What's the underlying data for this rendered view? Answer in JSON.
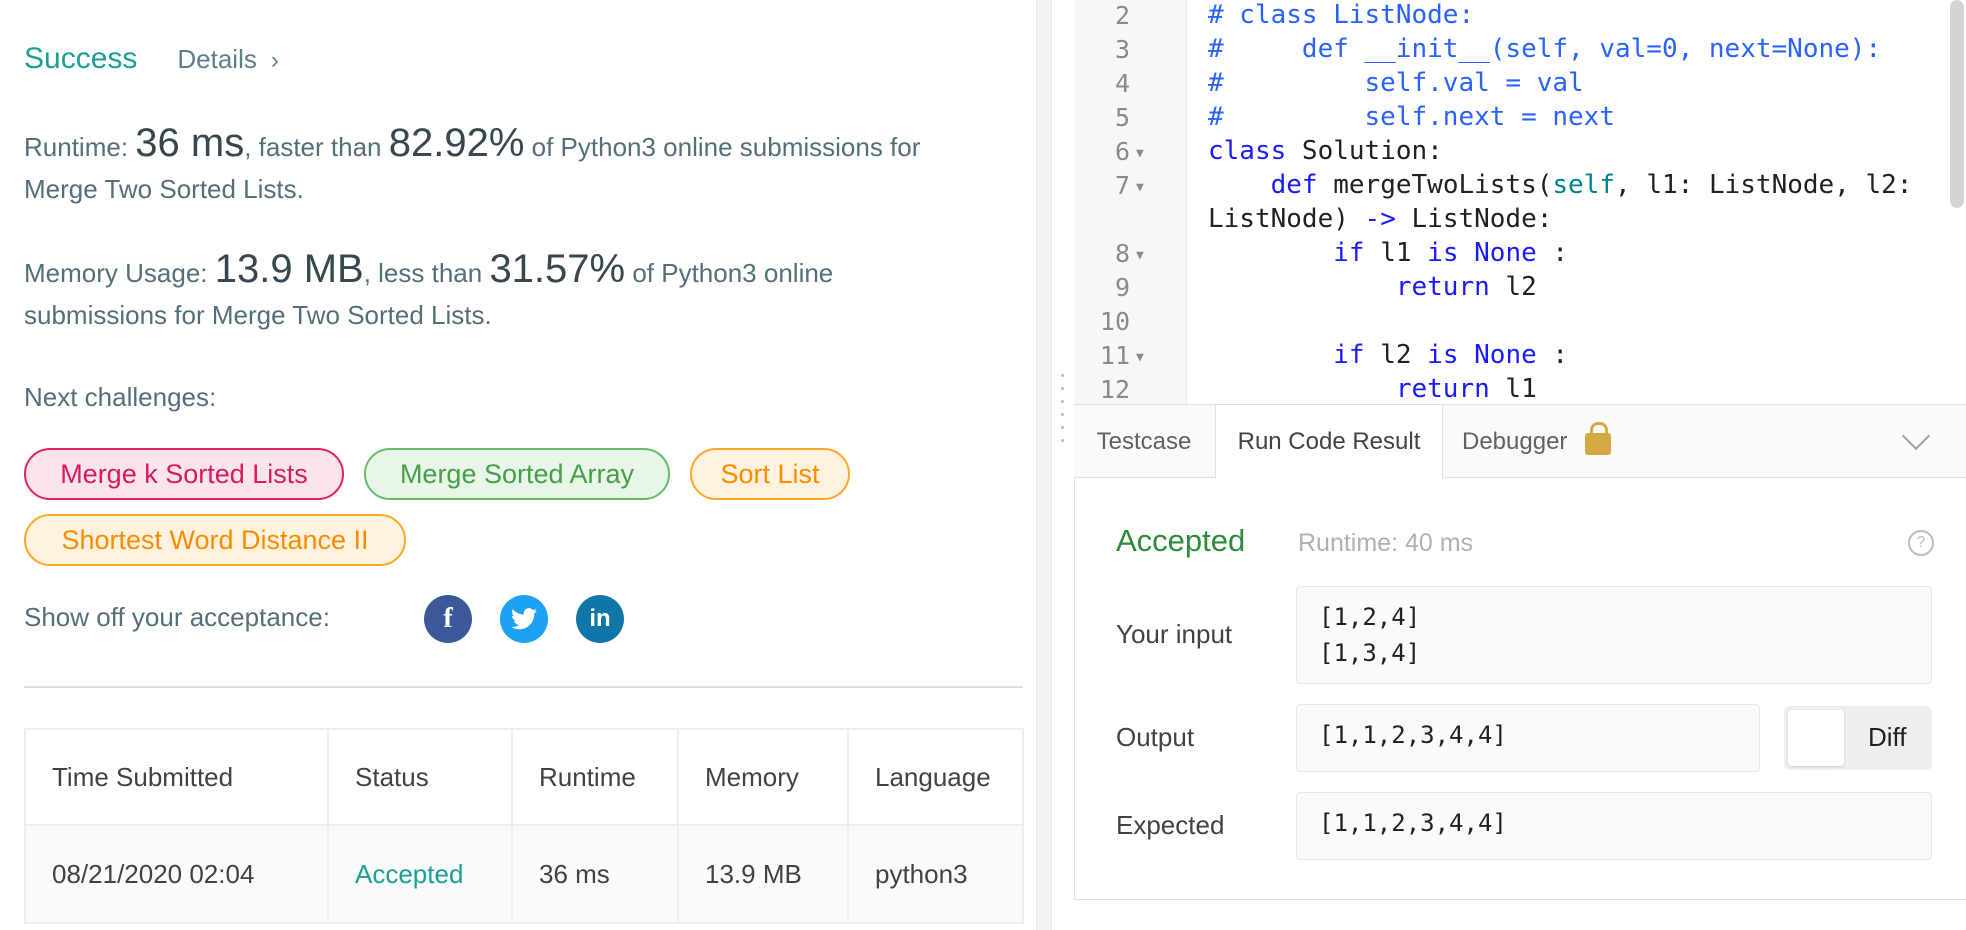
{
  "result": {
    "status": "Success",
    "details_label": "Details",
    "runtime": {
      "prefix": "Runtime: ",
      "value": "36 ms",
      "mid": ", faster than ",
      "percent": "82.92%",
      "suffix1": " of Python3 online submissions for",
      "suffix2": "Merge Two Sorted Lists."
    },
    "memory": {
      "prefix": "Memory Usage: ",
      "value": "13.9 MB",
      "mid": ", less than ",
      "percent": "31.57%",
      "suffix1": " of Python3 online",
      "suffix2": "submissions for Merge Two Sorted Lists."
    },
    "next_label": "Next challenges:",
    "challenges": [
      "Merge k Sorted Lists",
      "Merge Sorted Array",
      "Sort List",
      "Shortest Word Distance II"
    ],
    "share_label": "Show off your acceptance:",
    "social": {
      "facebook": "f",
      "twitter": "t",
      "linkedin": "in"
    }
  },
  "table": {
    "headers": [
      "Time Submitted",
      "Status",
      "Runtime",
      "Memory",
      "Language"
    ],
    "rows": [
      [
        "08/21/2020 02:04",
        "Accepted",
        "36 ms",
        "13.9 MB",
        "python3"
      ]
    ]
  },
  "editor": {
    "line_numbers": [
      "2",
      "3",
      "4",
      "5",
      "6",
      "7",
      "",
      "8",
      "9",
      "10",
      "11",
      "12"
    ],
    "code": {
      "l2": "# class ListNode:",
      "l3": "#     def __init__(self, val=0, next=None):",
      "l4": "#         self.val = val",
      "l5": "#         self.next = next",
      "l6_kw": "class",
      "l6_rest": " Solution:",
      "l7_kw": "def",
      "l7_a": " mergeTwoLists(",
      "l7_self": "self",
      "l7_b": ", l1: ListNode, l2:",
      "l7b_a": "ListNode) ",
      "l7b_arrow": "->",
      "l7b_b": " ListNode:",
      "l8_kw": "if",
      "l8_a": " l1 ",
      "l8_kw2": "is None",
      "l8_b": " :",
      "l9_kw": "return",
      "l9_a": " l2",
      "l11_kw": "if",
      "l11_a": " l2 ",
      "l11_kw2": "is None",
      "l11_b": " :",
      "l12_kw": "return",
      "l12_a": " l1"
    }
  },
  "console": {
    "tabs": [
      "Testcase",
      "Run Code Result",
      "Debugger"
    ],
    "status": "Accepted",
    "runtime": "Runtime: 40 ms",
    "help": "?",
    "input_label": "Your input",
    "input_value": "[1,2,4]\n[1,3,4]",
    "output_label": "Output",
    "output_value": "[1,1,2,3,4,4]",
    "diff_label": "Diff",
    "expected_label": "Expected",
    "expected_value": "[1,1,2,3,4,4]"
  },
  "colors": {
    "success": "#1ba092",
    "accepted": "#2e8b3a",
    "facebook": "#3b5998",
    "twitter": "#1da1f2",
    "linkedin": "#0e76a8"
  }
}
